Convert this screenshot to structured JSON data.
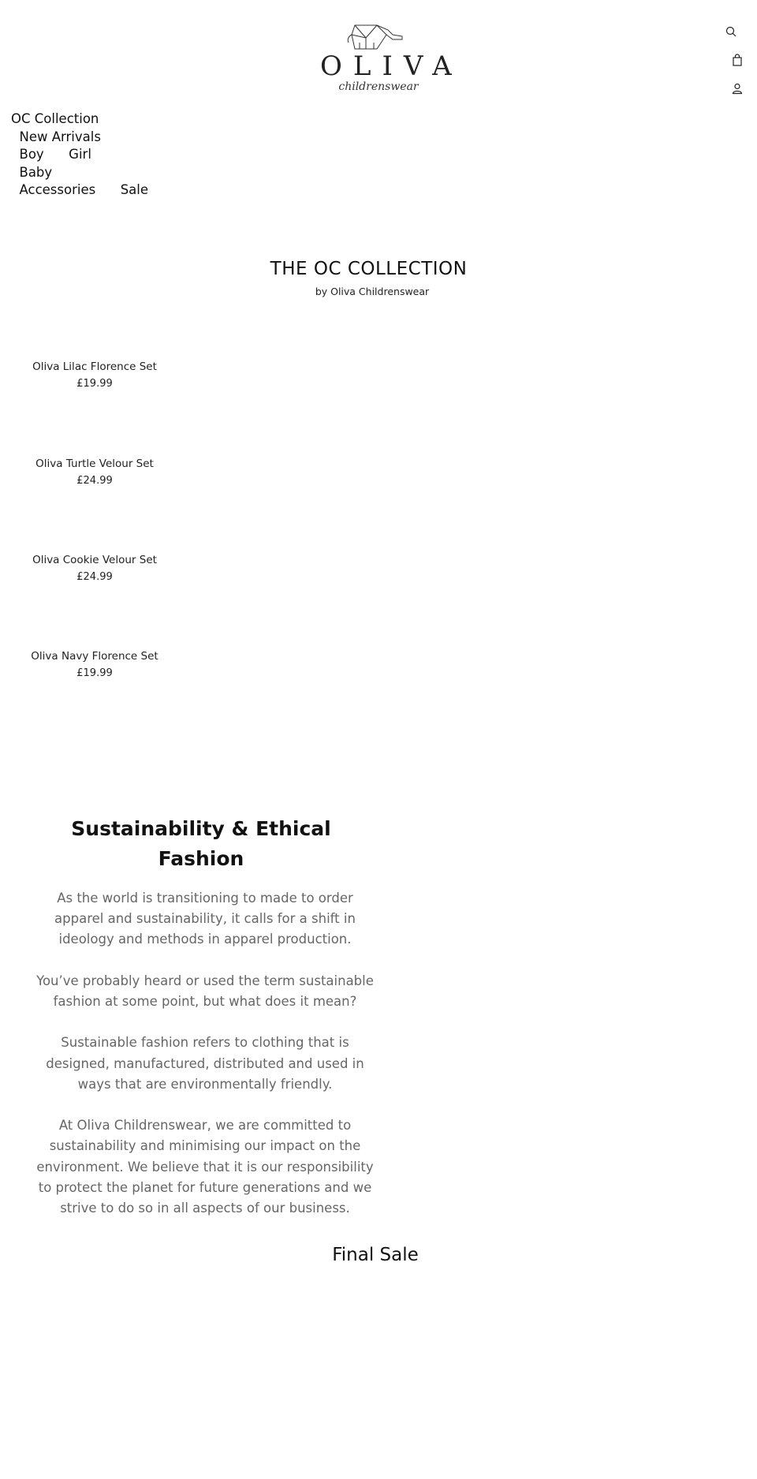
{
  "header": {
    "logo": {
      "word": "OLIVA",
      "tagline": "childrenswear"
    },
    "icons": {
      "search": "search-icon",
      "cart": "shopping-bag-icon",
      "account": "user-icon"
    }
  },
  "nav": {
    "items": [
      {
        "label": "OC Collection"
      },
      {
        "label": "New Arrivals"
      },
      {
        "label": "Boy"
      },
      {
        "label": "Girl"
      },
      {
        "label": "Baby"
      },
      {
        "label": "Accessories"
      },
      {
        "label": "Sale"
      }
    ]
  },
  "collection": {
    "title": "THE OC COLLECTION",
    "subtitle": "by Oliva Childrenswear"
  },
  "products": [
    {
      "name": "Oliva Lilac Florence Set",
      "price": "£19.99"
    },
    {
      "name": "Oliva Turtle Velour Set",
      "price": "£24.99"
    },
    {
      "name": "Oliva Cookie Velour Set",
      "price": "£24.99"
    },
    {
      "name": "Oliva Navy Florence Set",
      "price": "£19.99"
    }
  ],
  "sustainability": {
    "title": "Sustainability & Ethical Fashion",
    "paragraphs": [
      "As the world is transitioning to made to order apparel and sustainability, it calls for a shift in ideology and methods in apparel production.",
      "You’ve probably heard or used the term sustainable fashion at some point, but what does it mean?",
      "Sustainable fashion refers to clothing that is designed, manufactured, distributed and used in ways that are environmentally friendly.",
      "At Oliva Childrenswear, we are committed to sustainability and minimising our impact on the environment. We believe that it is our responsibility to protect the planet for future generations and we strive to do so in all aspects of our business."
    ]
  },
  "final_sale": {
    "title": "Final Sale"
  }
}
